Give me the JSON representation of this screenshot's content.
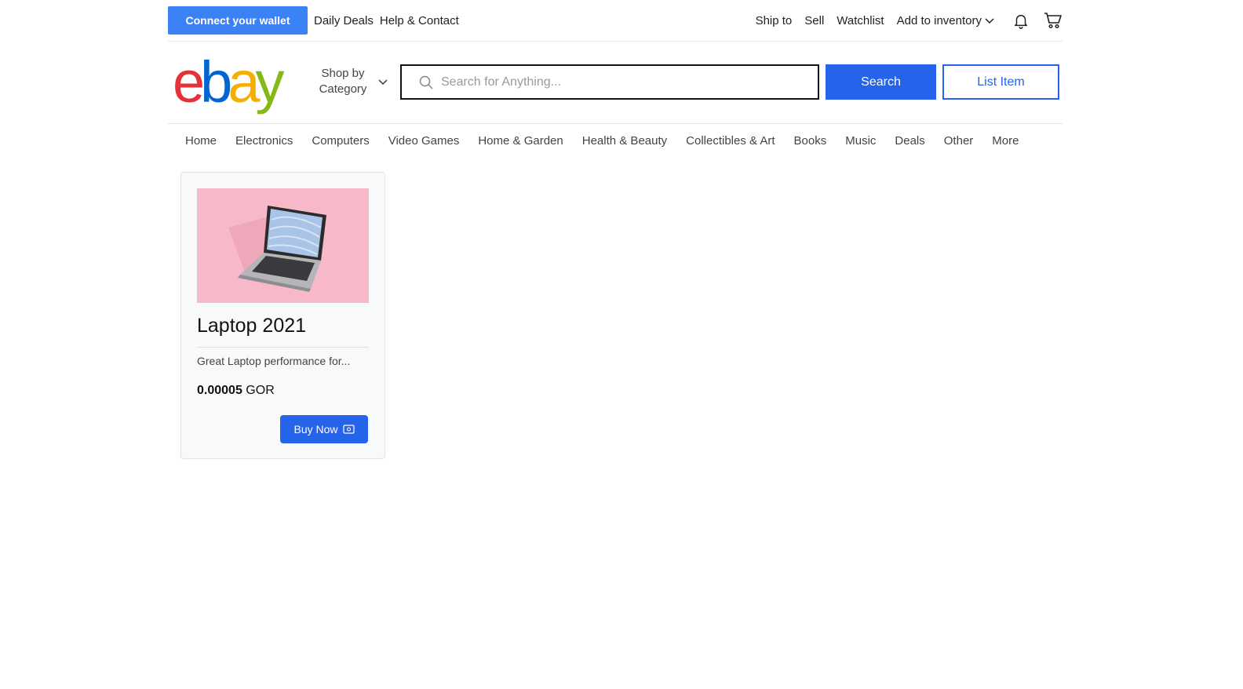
{
  "topbar": {
    "wallet_label": "Connect your wallet",
    "daily_deals": "Daily Deals",
    "help_contact": "Help & Contact",
    "ship_to": "Ship to",
    "sell": "Sell",
    "watchlist": "Watchlist",
    "add_inventory": "Add to inventory",
    "icons": [
      "bell-icon",
      "cart-icon"
    ]
  },
  "header": {
    "logo": {
      "letters": [
        "e",
        "b",
        "a",
        "y"
      ],
      "colors": [
        "#e53238",
        "#0064d2",
        "#f5af02",
        "#86b817"
      ]
    },
    "shop_by_line1": "Shop by",
    "shop_by_line2": "Category",
    "search_placeholder": "Search for Anything...",
    "search_label": "Search",
    "list_item_label": "List Item",
    "accent_color": "#2563eb"
  },
  "nav": {
    "items": [
      "Home",
      "Electronics",
      "Computers",
      "Video Games",
      "Home & Garden",
      "Health & Beauty",
      "Collectibles & Art",
      "Books",
      "Music",
      "Deals",
      "Other",
      "More"
    ]
  },
  "product": {
    "title": "Laptop 2021",
    "description": "Great Laptop performance for...",
    "price": "0.00005",
    "currency": "GOR",
    "buy_label": "Buy Now"
  }
}
